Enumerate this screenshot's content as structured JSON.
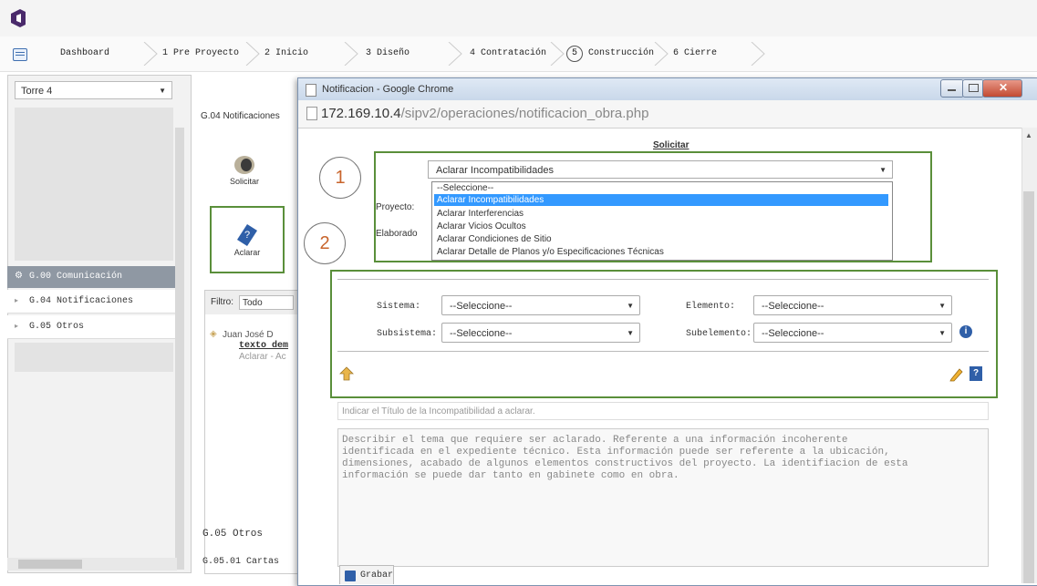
{
  "steps": [
    {
      "label": "Dashboard",
      "num": ""
    },
    {
      "label": "Pre Proyecto",
      "num": "1"
    },
    {
      "label": "Inicio",
      "num": "2"
    },
    {
      "label": "Diseño",
      "num": "3"
    },
    {
      "label": "Contratación",
      "num": "4"
    },
    {
      "label": "Construcción",
      "num": "5"
    },
    {
      "label": "Cierre",
      "num": "6"
    }
  ],
  "left": {
    "select_value": "Torre 4",
    "group": "G.00 Comunicación",
    "items": [
      "G.04 Notificaciones",
      "G.05 Otros"
    ]
  },
  "middle": {
    "title": "G.04 Notificaciones",
    "solicitar_label": "Solicitar",
    "aclarar_label": "Aclarar",
    "filter_label": "Filtro:",
    "filter_value": "Todo",
    "list_author": "Juan José D",
    "list_text": "texto dem",
    "list_sub": "Aclarar - Ac",
    "otros": "G.05 Otros",
    "cartas": "G.05.01 Cartas"
  },
  "popup": {
    "window_title": "Notificacion - Google Chrome",
    "url_host": "172.169.10.4",
    "url_path": "/sipv2/operaciones/notificacion_obra.php",
    "form_title": "Solicitar",
    "tipo_selected": "Aclarar Incompatibilidades",
    "options": [
      "--Seleccione--",
      "Aclarar Incompatibilidades",
      "Aclarar Interferencias",
      "Aclarar Vicios Ocultos",
      "Aclarar Condiciones de Sitio",
      "Aclarar Detalle de Planos y/o Especificaciones Técnicas"
    ],
    "proyecto_label": "Proyecto:",
    "elaborado_label": "Elaborado",
    "sistema_label": "Sistema:",
    "subsistema_label": "Subsistema:",
    "elemento_label": "Elemento:",
    "subelemento_label": "Subelemento:",
    "select_placeholder": "--Seleccione--",
    "titulo_placeholder": "Indicar el Título de la Incompatibilidad a aclarar.",
    "descripcion_placeholder": "Describir el tema que requiere ser aclarado. Referente a una información incoherente\nidentificada en el expediente técnico. Esta información puede ser referente a la ubicación,\ndimensiones, acabado de algunos elementos constructivos del proyecto. La identifiacion de esta\ninformación se puede dar tanto en gabinete como en obra.",
    "grabar_label": "Grabar"
  },
  "callouts": [
    "1",
    "2"
  ],
  "colors": {
    "highlight": "#5a8f3a",
    "selection": "#3399ff",
    "callout_text": "#c8642c"
  }
}
